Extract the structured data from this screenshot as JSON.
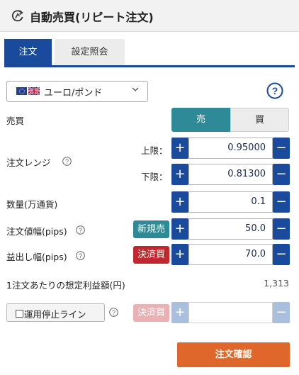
{
  "header": {
    "title": "自動売買(リピート注文)",
    "icon": "repeat-cycle-icon"
  },
  "tabs": [
    {
      "label": "注文",
      "active": true
    },
    {
      "label": "設定照会",
      "active": false
    }
  ],
  "currency_pair": {
    "label": "ユーロ/ポンド",
    "flags": [
      "eu-flag-icon",
      "uk-flag-icon"
    ]
  },
  "help": {
    "icon": "help-circle-icon"
  },
  "trade": {
    "label": "売買",
    "sell_label": "売",
    "buy_label": "買",
    "selected": "売"
  },
  "range": {
    "label": "注文レンジ",
    "upper_label": "上限：",
    "upper_value": "0.95000",
    "lower_label": "下限：",
    "lower_value": "0.81300"
  },
  "quantity": {
    "label": "数量(万通貨)",
    "value": "0.1"
  },
  "order_width": {
    "label": "注文値幅(pips)",
    "badge": "新規売",
    "value": "50.0"
  },
  "take_profit": {
    "label": "益出し幅(pips)",
    "badge": "決済買",
    "value": "70.0"
  },
  "expected_profit": {
    "label": "1注文あたりの想定利益額(円)",
    "value": "1,313"
  },
  "stop_line": {
    "label": "運用停止ライン",
    "badge": "決済買",
    "value": "",
    "enabled": false
  },
  "stepper": {
    "plus": "+",
    "minus": "−"
  },
  "confirm": {
    "label": "注文確認"
  },
  "colors": {
    "primary": "#1a4a9c",
    "sell": "#2e8a96",
    "settle": "#c0282e",
    "confirm": "#e0672c"
  }
}
